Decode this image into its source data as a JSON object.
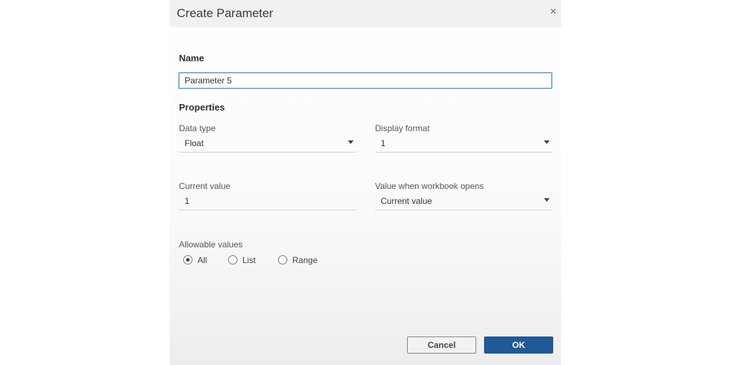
{
  "dialog": {
    "title": "Create Parameter",
    "close_glyph": "×"
  },
  "name": {
    "label": "Name",
    "value": "Parameter 5"
  },
  "properties": {
    "label": "Properties",
    "data_type": {
      "label": "Data type",
      "value": "Float"
    },
    "display_format": {
      "label": "Display format",
      "value": "1"
    },
    "current_value": {
      "label": "Current value",
      "value": "1"
    },
    "value_when_opens": {
      "label": "Value when workbook opens",
      "value": "Current value"
    }
  },
  "allowable_values": {
    "label": "Allowable values",
    "options": [
      {
        "label": "All",
        "selected": true
      },
      {
        "label": "List",
        "selected": false
      },
      {
        "label": "Range",
        "selected": false
      }
    ]
  },
  "buttons": {
    "cancel": "Cancel",
    "ok": "OK"
  },
  "colors": {
    "ok_button": "#1f5a96",
    "input_focus_border": "#7db3d8"
  }
}
